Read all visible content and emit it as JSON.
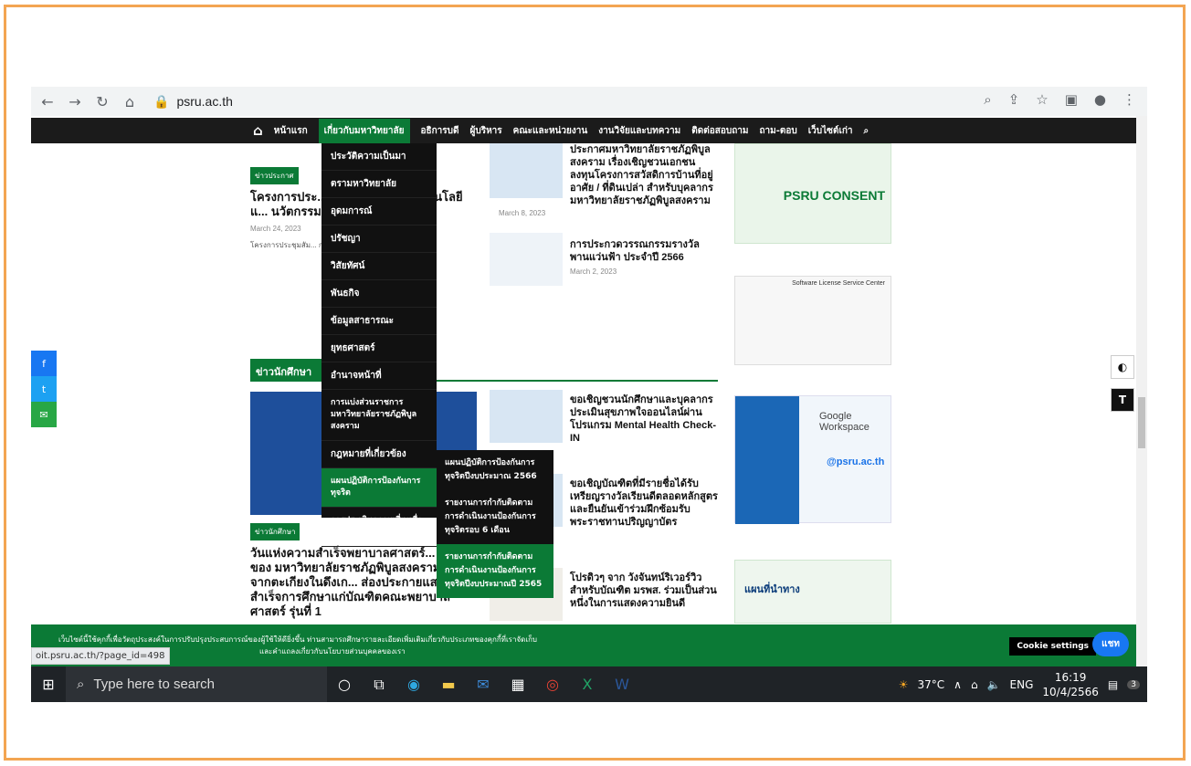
{
  "browser": {
    "url": "psru.ac.th",
    "status_url": "oit.psru.ac.th/?page_id=498"
  },
  "nav": {
    "items": [
      "หน้าแรก",
      "เกี่ยวกับมหาวิทยาลัย",
      "อธิการบดี",
      "ผู้บริหาร",
      "คณะและหน่วยงาน",
      "งานวิจัยและบทความ",
      "ติดต่อสอบถาม",
      "ถาม-ตอบ",
      "เว็บไซต์เก่า"
    ]
  },
  "dropdown": [
    "ประวัติความเป็นมา",
    "ตรามหาวิทยาลัย",
    "อุดมการณ์",
    "ปรัชญา",
    "วิสัยทัศน์",
    "พันธกิจ",
    "ข้อมูลสาธารณะ",
    "ยุทธศาสตร์",
    "อำนาจหน้าที่",
    "การแบ่งส่วนราชการมหาวิทยาลัยราชภัฏพิบูลสงคราม",
    "กฎหมายที่เกี่ยวข้อง",
    "แผนปฏิบัติการป้องกันการทุจริต",
    "การประเมินความเสี่ยงเพื่อป้องกันการทุจริต"
  ],
  "submenu": [
    "แผนปฏิบัติการป้องกันการทุจริตปีงบประมาณ 2566",
    "รายงานการกำกับติดตามการดำเนินงานป้องกันการทุจริตรอบ 6 เดือน",
    "รายงานการกำกับติดตามการดำเนินงานป้องกันการทุจริตปีงบประมาณปี 2565"
  ],
  "posts": {
    "left_tag": "ข่าวประกาศ",
    "left_title": "โครงการประ... ผู้บริหารมหา... เทคโนโลยีแ... นวัตกรรม)",
    "left_date": "March 24, 2023",
    "left_excerpt": "โครงการประชุมสัม... กลุ่ม 2 (กลุ่มพัฒนา... ครั้งที่ 1",
    "right1_title": "ประกาศมหาวิทยาลัยราชภัฏพิบูลสงคราม เรื่องเชิญชวนเอกชนลงทุนโครงการสวัสดิการบ้านที่อยู่อาศัย / ที่ดินเปล่า สำหรับบุคลากรมหาวิทยาลัยราชภัฏพิบูลสงคราม",
    "right1_date": "March 8, 2023",
    "right2_title": "การประกวดวรรณกรรมรางวัลพานแว่นฟ้า ประจำปี 2566",
    "right2_date": "March 2, 2023",
    "section": "ข่าวนักศึกษา",
    "student_tag": "ข่าวนักศึกษา",
    "student_title": "วันแห่งความสำเร็จพยาบาลศาสตร์... แรกของ มหาวิทยาลัยราชภัฏพิบูลสงคราม “เทียบจากตะเกียงในดึงเก... ส่องประกายแสงในวันสำเร็จการศึกษาแก่บัณฑิตคณะพยาบาลศาสตร์ รุ่นที่ 1",
    "s1": "ขอเชิญชวนนักศึกษาและบุคลากรประเมินสุขภาพใจออนไลน์ผ่านโปรแกรม Mental Health Check-IN",
    "s2": "ขอเชิญบัณฑิตที่มีรายชื่อได้รับเหรียญรางวัลเรียนดีตลอดหลักสูตร และยืนยันเข้าร่วมฝึกซ้อมรับพระราชทานปริญญาบัตร",
    "s3": "โปรดิวๆ จาก วังจันทน์ริเวอร์วิวสำหรับบัณฑิต มรพส. ร่วมเป็นส่วนหนึ่งในการแสดงความยินดี"
  },
  "ads": {
    "a1": "PSRU CONSENT",
    "a2": "Software License Service Center",
    "a3": "Google Workspace",
    "a3b": "@psru.ac.th",
    "a4": "แผนที่นำทาง"
  },
  "cookie": {
    "text": "เว็บไซต์นี้ใช้คุกกี้เพื่อวัตถุประสงค์ในการปรับปรุงประสบการณ์ของผู้ใช้ให้ดียิ่งขึ้น ท่านสามารถศึกษารายละเอียดเพิ่มเติมเกี่ยวกับประเภทของคุกกี้ที่เราจัดเก็บ",
    "text2": "และคำแถลงเกี่ยวกับนโยบายส่วนบุคคลของเรา",
    "settings": "Cookie settings",
    "chat": "แชท"
  },
  "taskbar": {
    "search": "Type here to search",
    "temp": "37°C",
    "lang": "ENG",
    "time": "16:19",
    "date": "10/4/2566",
    "badge": "3"
  }
}
